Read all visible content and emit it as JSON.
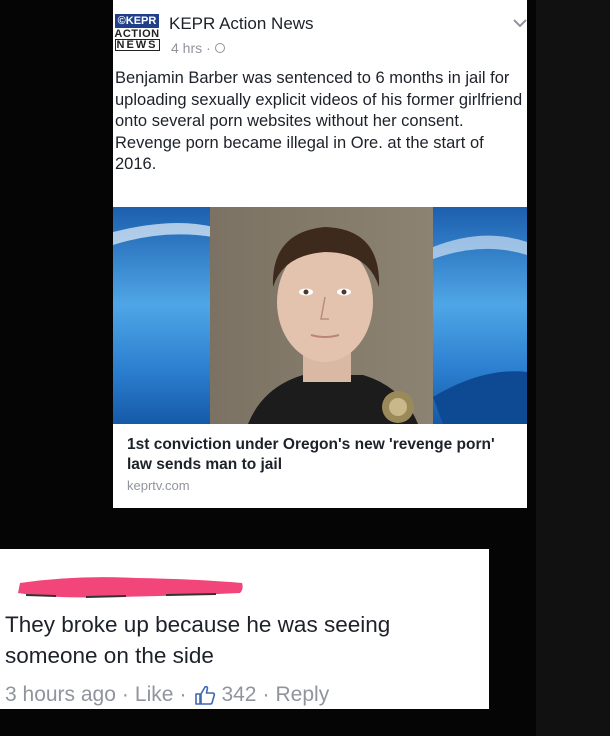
{
  "post": {
    "logo": {
      "line1": "©KEPR",
      "line2": "ACTION",
      "line3": "NEWS"
    },
    "page_name": "KEPR Action News",
    "time": "4 hrs",
    "dot": "·",
    "paragraphs": [
      "Benjamin Barber was sentenced to 6 months in jail for uploading sexually explicit videos of his former girlfriend onto several porn websites without her consent.",
      "Revenge porn became illegal in Ore. at the start of 2016."
    ],
    "link": {
      "title": "1st conviction under Oregon's new 'revenge porn' law sends man to jail",
      "domain": "keprtv.com"
    },
    "icons": [
      "globe-icon",
      "chevron-down-icon"
    ]
  },
  "comment": {
    "text": "They broke up because he was seeing someone on the side",
    "time": "3 hours ago",
    "like_label": "Like",
    "like_count": "342",
    "reply_label": "Reply",
    "dot": "·",
    "icons": [
      "thumbs-up-icon"
    ]
  },
  "colors": {
    "background": "#0a0a0a",
    "card": "#ffffff",
    "text": "#1d2129",
    "meta": "#90949c",
    "link_blue": "#4267b2",
    "redaction_pink": "#f2467a"
  }
}
